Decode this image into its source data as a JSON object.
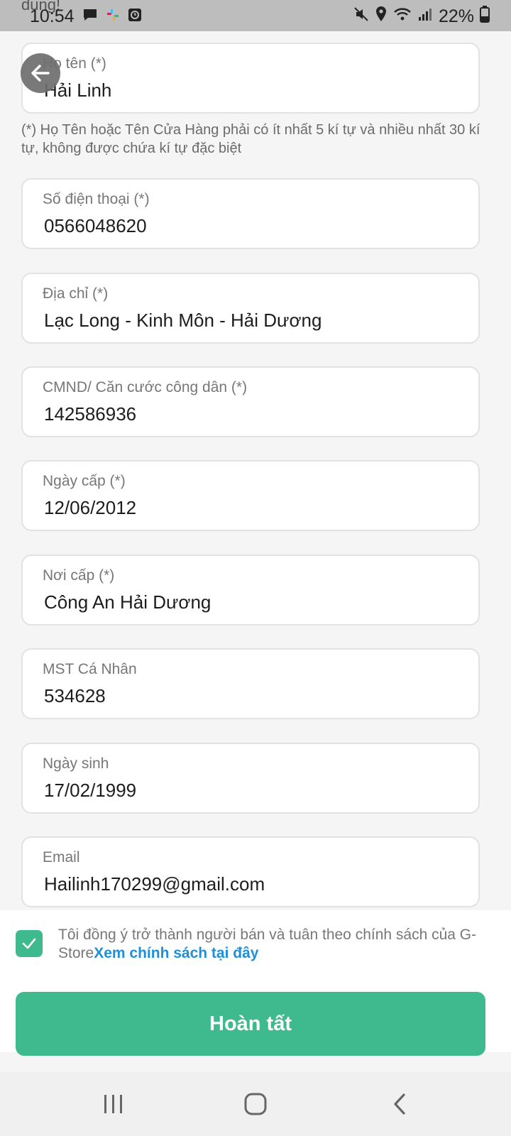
{
  "status_bar": {
    "behind_text": "dung!",
    "time": "10:54",
    "battery": "22%",
    "icons": [
      "chat-icon",
      "slack-icon",
      "alarm-app-icon",
      "mute-icon",
      "location-icon",
      "wifi-icon",
      "signal-icon",
      "battery-icon"
    ]
  },
  "header": {
    "back_icon": "arrow-left-icon"
  },
  "form": {
    "name": {
      "label": "Họ tên (*)",
      "value": "Hải Linh"
    },
    "name_hint": "(*) Họ Tên hoặc Tên Cửa Hàng phải có ít nhất 5 kí tự và nhiều nhất 30 kí tự, không được chứa kí tự đặc biệt",
    "phone": {
      "label": "Số điện thoại (*)",
      "value": "0566048620"
    },
    "address": {
      "label": "Địa chỉ (*)",
      "value": "Lạc Long - Kinh Môn - Hải Dương"
    },
    "id_card": {
      "label": "CMND/ Căn cước công dân (*)",
      "value": "142586936"
    },
    "issue_date": {
      "label": "Ngày cấp (*)",
      "value": "12/06/2012"
    },
    "issue_place": {
      "label": "Nơi cấp (*)",
      "value": "Công An Hải Dương"
    },
    "tax_code": {
      "label": "MST Cá Nhân",
      "value": "534628"
    },
    "birthday": {
      "label": "Ngày sinh",
      "value": "17/02/1999"
    },
    "email": {
      "label": "Email",
      "value": "Hailinh170299@gmail.com"
    }
  },
  "agreement": {
    "checked": true,
    "text": "Tôi đồng ý trở thành người bán và tuân theo chính sách của G-Store",
    "link": "Xem chính sách tại đây"
  },
  "submit_label": "Hoàn tất",
  "colors": {
    "accent": "#3fba8e",
    "link": "#1f8fd8"
  },
  "nav": [
    "recent-apps-icon",
    "home-icon",
    "back-icon"
  ]
}
